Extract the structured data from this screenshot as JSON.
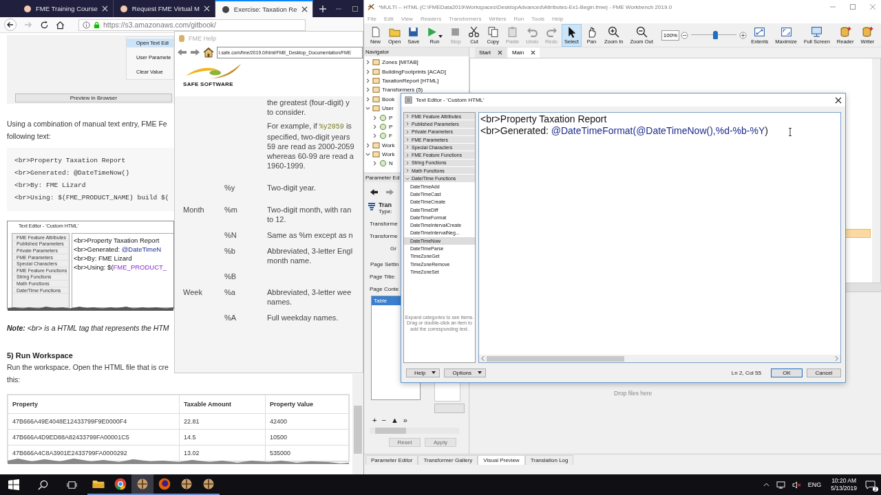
{
  "firefox": {
    "tabs": [
      {
        "label": "FME Training Course",
        "selected": false
      },
      {
        "label": "Request FME Virtual M",
        "selected": false
      },
      {
        "label": "Exercise: Taxation Re",
        "selected": true
      }
    ],
    "url": "https://s3.amazonaws.com/gitbook/",
    "context_menu": [
      {
        "label": "Open Text Edi",
        "selected": true
      },
      {
        "label": "User Paramete",
        "selected": false
      },
      {
        "label": "Clear Value",
        "selected": false
      }
    ],
    "preview_button": "Preview in Browser",
    "intro": [
      "Using a combination of manual text entry, FME Fe",
      "following text:"
    ],
    "code_lines": [
      "<br>Property Taxation Report",
      "<br>Generated: @DateTimeNow()",
      "<br>By: FME Lizard",
      "<br>Using: $(FME_PRODUCT_NAME) build $("
    ],
    "embedded_editor": {
      "title": "Text Editor - 'Custom HTML'",
      "categories": [
        "FME Feature Attributes",
        "Published Parameters",
        "Private Parameters",
        "FME Parameters",
        "Special Characters",
        "FME Feature Functions",
        "String Functions",
        "Math Functions",
        "Date/Time Functions"
      ],
      "lines": [
        [
          {
            "kind": "plain",
            "text": "<br>Property Taxation Report"
          }
        ],
        [
          {
            "kind": "plain",
            "text": "<br>Generated: "
          },
          {
            "kind": "function",
            "text": "@DateTimeN"
          }
        ],
        [
          {
            "kind": "plain",
            "text": "<br>By: FME Lizard"
          }
        ],
        [
          {
            "kind": "plain",
            "text": "<br>Using: $("
          },
          {
            "kind": "parameter",
            "text": "FME_PRODUCT_"
          }
        ]
      ]
    },
    "note": "**Note:** <br> is a HTML tag that represents the HTM",
    "heading": "5) Run Workspace",
    "run_text": [
      "Run the workspace. Open the HTML file that is cre",
      "this:"
    ],
    "table": {
      "columns": [
        "Property",
        "Taxable Amount",
        "Property Value"
      ],
      "rows": [
        [
          "47B666A49E4048E12433799F9E0000F4",
          "22.81",
          "42400"
        ],
        [
          "47B666A4D9ED88A82433799FA00001C5",
          "14.5",
          "10500"
        ],
        [
          "47B666A4C8A3901E2433799FA0000292",
          "13.02",
          "535000"
        ]
      ]
    }
  },
  "help": {
    "title": "FME Help",
    "url": "i.safe.com/fme/2019.0/html/FME_Desktop_Documentation/FME",
    "logo": "SAFE SOFTWARE",
    "paragraphs": [
      [
        [
          {
            "kind": "plain",
            "text": "the greatest (four-digit) y"
          }
        ],
        [
          {
            "kind": "plain",
            "text": "to consider."
          }
        ]
      ],
      [
        [
          {
            "kind": "plain",
            "text": "For example, if "
          },
          {
            "kind": "code",
            "text": "%y2059"
          },
          {
            "kind": "plain",
            "text": " is"
          }
        ],
        [
          {
            "kind": "plain",
            "text": "specified, two-digit years"
          }
        ],
        [
          {
            "kind": "plain",
            "text": "59 are read as 2000-2059"
          }
        ],
        [
          {
            "kind": "plain",
            "text": "whereas 60-99 are read a"
          }
        ],
        [
          {
            "kind": "plain",
            "text": "1960-1999."
          }
        ]
      ]
    ],
    "rows": [
      {
        "code": "%y",
        "desc": [
          "Two-digit year."
        ]
      },
      {
        "group": "Month",
        "code": "%m",
        "desc": [
          "Two-digit month, with ran",
          "to 12."
        ]
      },
      {
        "code": "%N",
        "desc": [
          "Same as %m except as n"
        ]
      },
      {
        "code": "%b",
        "desc": [
          "Abbreviated, 3-letter Engl",
          "month name."
        ]
      },
      {
        "code": "%B"
      },
      {
        "group": "Week",
        "code": "%a",
        "desc": [
          "Abbreviated, 3-letter wee",
          "names."
        ]
      },
      {
        "code": "%A",
        "desc": [
          "Full weekday names."
        ]
      }
    ]
  },
  "workbench": {
    "title": "*MULTI -- HTML (C:\\FMEData2019\\Workspaces\\DesktopAdvanced\\Attributes-Ex1-Begin.fmw) - FME Workbench 2019.0",
    "menu": [
      "File",
      "Edit",
      "View",
      "Readers",
      "Transformers",
      "Writers",
      "Run",
      "Tools",
      "Help"
    ],
    "toolbar": [
      {
        "kind": "new",
        "label": "New",
        "disabled": false,
        "selected": false
      },
      {
        "kind": "open",
        "label": "Open",
        "disabled": false,
        "selected": false
      },
      {
        "kind": "save",
        "label": "Save",
        "disabled": false,
        "selected": false
      },
      {
        "kind": "run",
        "label": "Run",
        "disabled": false,
        "selected": false
      },
      {
        "kind": "stop",
        "label": "Stop",
        "disabled": true,
        "selected": false
      },
      {
        "kind": "cut",
        "label": "Cut",
        "disabled": false,
        "selected": false
      },
      {
        "kind": "copy",
        "label": "Copy",
        "disabled": false,
        "selected": false
      },
      {
        "kind": "paste",
        "label": "Paste",
        "disabled": true,
        "selected": false
      },
      {
        "kind": "undo",
        "label": "Undo",
        "disabled": true,
        "selected": false
      },
      {
        "kind": "redo",
        "label": "Redo",
        "disabled": true,
        "selected": false
      },
      {
        "kind": "select",
        "label": "Select",
        "disabled": false,
        "selected": true
      },
      {
        "kind": "pan",
        "label": "Pan",
        "disabled": false,
        "selected": false
      },
      {
        "kind": "zoomin",
        "label": "Zoom In",
        "disabled": false,
        "selected": false
      },
      {
        "kind": "zoomout",
        "label": "Zoom Out",
        "disabled": false,
        "selected": false
      }
    ],
    "zoom": {
      "value": "100%",
      "level": 0.53
    },
    "toolbar_right": [
      {
        "kind": "extents",
        "label": "Extents",
        "disabled": false,
        "selected": false
      },
      {
        "kind": "maximize",
        "label": "Maximize",
        "disabled": false,
        "selected": false
      },
      {
        "kind": "fullscreen",
        "label": "Full Screen",
        "disabled": false,
        "selected": false
      },
      {
        "kind": "reader",
        "label": "Reader",
        "disabled": false,
        "selected": false
      },
      {
        "kind": "writer",
        "label": "Writer",
        "disabled": false,
        "selected": false
      }
    ],
    "navigator": {
      "title": "Navigator",
      "items": [
        {
          "label": "Zones [MITAB]",
          "expanded": false
        },
        {
          "label": "BuildingFootprints [ACAD]",
          "expanded": false
        },
        {
          "label": "TaxationReport [HTML]",
          "expanded": false
        },
        {
          "label": "Transformers (5)",
          "expanded": false
        },
        {
          "label": "Book",
          "expanded": false
        },
        {
          "label": "User",
          "expanded": true,
          "children": [
            {
              "label": "P",
              "expanded": false
            },
            {
              "label": "P",
              "expanded": false
            },
            {
              "label": "F",
              "expanded": false
            }
          ]
        },
        {
          "label": "Work",
          "expanded": false
        },
        {
          "label": "Work",
          "expanded": true,
          "children": [
            {
              "label": "N",
              "expanded": false
            }
          ]
        }
      ]
    },
    "parameter_editor": {
      "title": "Parameter Ed",
      "name": "Tran",
      "type": "Type:",
      "labels": [
        "Transforme",
        "Transforme"
      ],
      "group_label": "Gr",
      "section_label": "Page Settin",
      "fields": [
        "Page Title:",
        "Page Conte"
      ],
      "list": [
        {
          "label": "Table",
          "selected": true
        }
      ],
      "list_buttons": [
        "+",
        "−",
        "▲",
        "»"
      ],
      "reset": "Reset",
      "apply": "Apply"
    },
    "canvas_tabs": [
      {
        "label": "Start",
        "selected": false
      },
      {
        "label": "Main",
        "selected": true
      }
    ],
    "drop_hint": "Drop files here",
    "bottom_tabs": [
      {
        "label": "Parameter Editor",
        "selected": false
      },
      {
        "label": "Transformer Gallery",
        "selected": false
      },
      {
        "label": "Visual Preview",
        "selected": true
      },
      {
        "label": "Translation Log",
        "selected": false
      }
    ]
  },
  "text_editor": {
    "title": "Text Editor - 'Custom HTML'",
    "categories": [
      {
        "label": "FME Feature Attributes",
        "expanded": false
      },
      {
        "label": "Published Parameters",
        "expanded": false
      },
      {
        "label": "Private Parameters",
        "expanded": false
      },
      {
        "label": "FME Parameters",
        "expanded": false
      },
      {
        "label": "Special Characters",
        "expanded": false
      },
      {
        "label": "FME Feature Functions",
        "expanded": false
      },
      {
        "label": "String Functions",
        "expanded": false
      },
      {
        "label": "Math Functions",
        "expanded": false
      },
      {
        "label": "Date/Time Functions",
        "expanded": true,
        "children": [
          {
            "label": "DateTimeAdd",
            "selected": false
          },
          {
            "label": "DateTimeCast",
            "selected": false
          },
          {
            "label": "DateTimeCreate",
            "selected": false
          },
          {
            "label": "DateTimeDiff",
            "selected": false
          },
          {
            "label": "DateTimeFormat",
            "selected": false
          },
          {
            "label": "DateTimeIntervalCreate",
            "selected": false
          },
          {
            "label": "DateTimeIntervalNeg...",
            "selected": false
          },
          {
            "label": "DateTimeNow",
            "selected": true
          },
          {
            "label": "DateTimeParse",
            "selected": false
          },
          {
            "label": "TimeZoneGet",
            "selected": false
          },
          {
            "label": "TimeZoneRemove",
            "selected": false
          },
          {
            "label": "TimeZoneSet",
            "selected": false
          }
        ]
      }
    ],
    "hint": "Expand categories to see items. Drag or double-click an item to add the corresponding text.",
    "lines": [
      [
        {
          "kind": "plain",
          "text": "<br>Property Taxation Report"
        }
      ],
      [
        {
          "kind": "plain",
          "text": "<br>Generated: "
        },
        {
          "kind": "function",
          "text": "@DateTimeFormat(@DateTimeNow(),%d-%b-%Y"
        },
        {
          "kind": "plain",
          "text": ")"
        }
      ]
    ],
    "help_button": "Help",
    "options_button": "Options",
    "status": "Ln 2, Col 55",
    "ok_button": "OK",
    "cancel_button": "Cancel"
  },
  "taskbar": {
    "apps": [
      {
        "kind": "explorer",
        "active": false
      },
      {
        "kind": "chrome",
        "active": false
      },
      {
        "kind": "fme",
        "active": true
      },
      {
        "kind": "firefox",
        "active": false
      },
      {
        "kind": "fme",
        "active": false
      },
      {
        "kind": "fme",
        "active": false
      }
    ],
    "language": "ENG",
    "time": "10:20 AM",
    "date": "5/13/2019",
    "notifications": "2"
  }
}
